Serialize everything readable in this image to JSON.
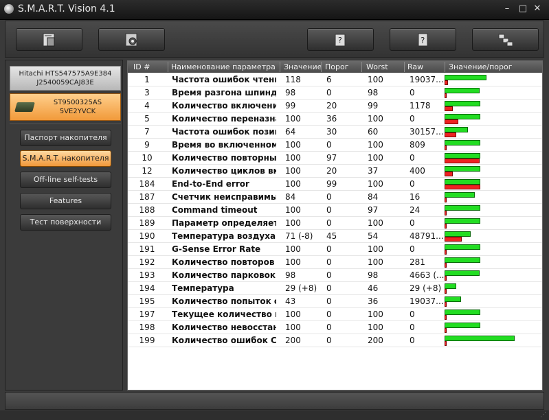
{
  "app": {
    "title": "S.M.A.R.T. Vision 4.1"
  },
  "window_controls": {
    "minimize": "–",
    "maximize": "□",
    "close": "✕"
  },
  "toolbar": {
    "buttons": [
      "disk-info-icon",
      "scan-disk-icon",
      "help-book-icon",
      "question-icon",
      "network-icon"
    ]
  },
  "drives": [
    {
      "line1": "Hitachi HTS547575A9E384",
      "line2": "J2540059CAJ83E"
    },
    {
      "line1": "ST9500325AS",
      "line2": "5VE2YVCK"
    }
  ],
  "nav": [
    "Паспорт накопителя",
    "S.M.A.R.T. накопителя",
    "Off-line self-tests",
    "Features",
    "Тест поверхности"
  ],
  "table": {
    "headers": [
      "ID #",
      "Наименование параметра",
      "Значение",
      "Порог",
      "Worst",
      "Raw",
      "Значение/порог"
    ],
    "rows": [
      {
        "id": "1",
        "name": "Частота ошибок чтения",
        "value": "118",
        "threshold": "6",
        "worst": "100",
        "raw": "19037..."
      },
      {
        "id": "3",
        "name": "Время разгона шпинделя",
        "value": "98",
        "threshold": "0",
        "worst": "98",
        "raw": "0"
      },
      {
        "id": "4",
        "name": "Количество включений ...",
        "value": "99",
        "threshold": "20",
        "worst": "99",
        "raw": "1178"
      },
      {
        "id": "5",
        "name": "Количество переназна...",
        "value": "100",
        "threshold": "36",
        "worst": "100",
        "raw": "0"
      },
      {
        "id": "7",
        "name": "Частота ошибок позиц...",
        "value": "64",
        "threshold": "30",
        "worst": "60",
        "raw": "30157..."
      },
      {
        "id": "9",
        "name": "Время во включенном ...",
        "value": "100",
        "threshold": "0",
        "worst": "100",
        "raw": "809"
      },
      {
        "id": "10",
        "name": "Количество повторных ...",
        "value": "100",
        "threshold": "97",
        "worst": "100",
        "raw": "0"
      },
      {
        "id": "12",
        "name": "Количество циклов вкл...",
        "value": "100",
        "threshold": "20",
        "worst": "37",
        "raw": "400"
      },
      {
        "id": "184",
        "name": "End-to-End error",
        "value": "100",
        "threshold": "99",
        "worst": "100",
        "raw": "0"
      },
      {
        "id": "187",
        "name": "Счетчик неисправимых...",
        "value": "84",
        "threshold": "0",
        "worst": "84",
        "raw": "16"
      },
      {
        "id": "188",
        "name": "Command timeout",
        "value": "100",
        "threshold": "0",
        "worst": "97",
        "raw": "24"
      },
      {
        "id": "189",
        "name": "Параметр определяетс...",
        "value": "100",
        "threshold": "0",
        "worst": "100",
        "raw": "0"
      },
      {
        "id": "190",
        "name": "Температура воздуха в...",
        "value": "71 (-8)",
        "threshold": "45",
        "worst": "54",
        "raw": "48791..."
      },
      {
        "id": "191",
        "name": "G-Sense Error Rate",
        "value": "100",
        "threshold": "0",
        "worst": "100",
        "raw": "0"
      },
      {
        "id": "192",
        "name": "Количество повторов в...",
        "value": "100",
        "threshold": "0",
        "worst": "100",
        "raw": "281"
      },
      {
        "id": "193",
        "name": "Количество парковок Б...",
        "value": "98",
        "threshold": "0",
        "worst": "98",
        "raw": "4663 (..."
      },
      {
        "id": "194",
        "name": "Температура",
        "value": "29 (+8)",
        "threshold": "0",
        "worst": "46",
        "raw": "29 (+8)"
      },
      {
        "id": "195",
        "name": "Количество попыток ст...",
        "value": "43",
        "threshold": "0",
        "worst": "36",
        "raw": "19037..."
      },
      {
        "id": "197",
        "name": "Текущее количество н...",
        "value": "100",
        "threshold": "0",
        "worst": "100",
        "raw": "0"
      },
      {
        "id": "198",
        "name": "Количество невосстан...",
        "value": "100",
        "threshold": "0",
        "worst": "100",
        "raw": "0"
      },
      {
        "id": "199",
        "name": "Количество ошибок CR...",
        "value": "200",
        "threshold": "0",
        "worst": "200",
        "raw": "0"
      }
    ],
    "bars": [
      {
        "value": 118,
        "threshold": 6
      },
      {
        "value": 98,
        "threshold": 0
      },
      {
        "value": 99,
        "threshold": 20
      },
      {
        "value": 100,
        "threshold": 36
      },
      {
        "value": 64,
        "threshold": 30
      },
      {
        "value": 100,
        "threshold": 0
      },
      {
        "value": 100,
        "threshold": 97
      },
      {
        "value": 100,
        "threshold": 20
      },
      {
        "value": 100,
        "threshold": 99
      },
      {
        "value": 84,
        "threshold": 0
      },
      {
        "value": 100,
        "threshold": 0
      },
      {
        "value": 100,
        "threshold": 0
      },
      {
        "value": 71,
        "threshold": 45
      },
      {
        "value": 100,
        "threshold": 0
      },
      {
        "value": 100,
        "threshold": 0
      },
      {
        "value": 98,
        "threshold": 0
      },
      {
        "value": 29,
        "threshold": 0
      },
      {
        "value": 43,
        "threshold": 0
      },
      {
        "value": 100,
        "threshold": 0
      },
      {
        "value": 100,
        "threshold": 0
      },
      {
        "value": 200,
        "threshold": 0
      }
    ]
  },
  "colors": {
    "value_bar": "#22dd22",
    "threshold_bar": "#ee2222",
    "active_accent": "#f1983a"
  }
}
